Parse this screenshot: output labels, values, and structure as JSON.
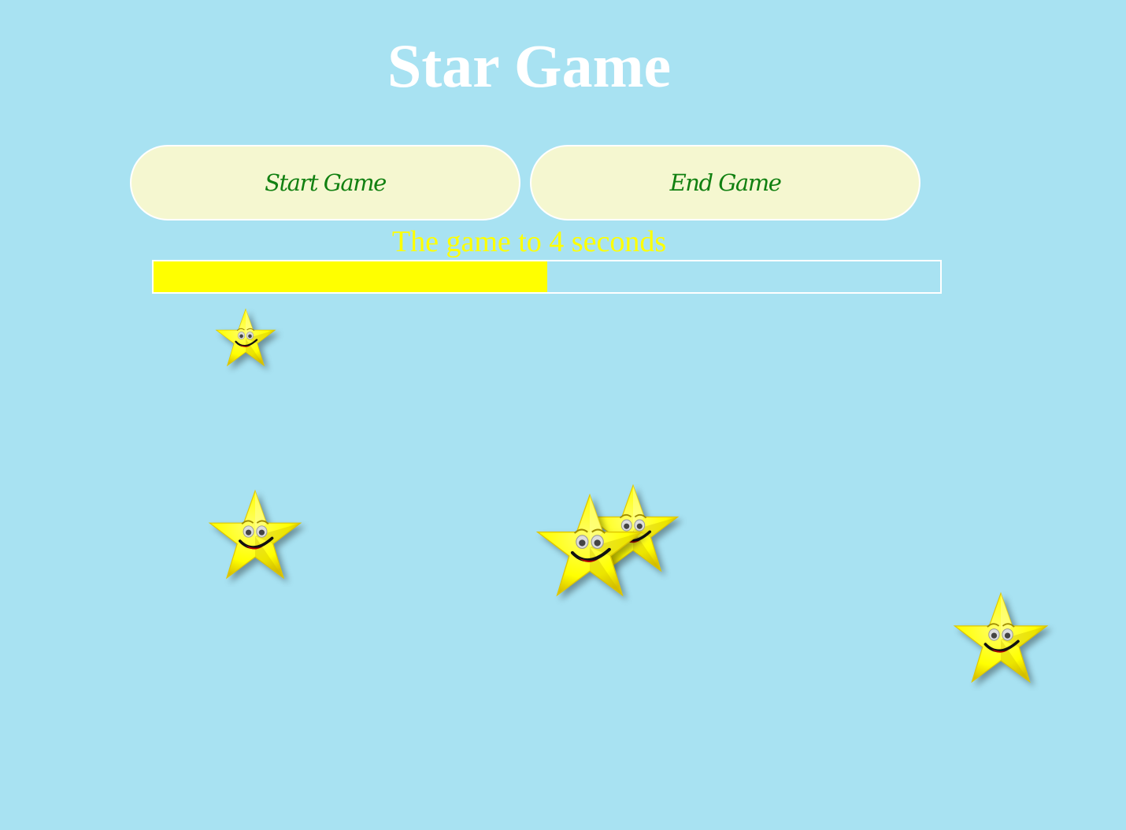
{
  "title": "Star Game",
  "buttons": {
    "start_label": "Start Game",
    "end_label": "End Game"
  },
  "status_text": "The game to 4 seconds",
  "timer": {
    "remaining_fraction": 0.5
  },
  "colors": {
    "background": "#a8e2f2",
    "title": "#ffffff",
    "button_bg": "#f5f7d0",
    "button_text": "#118011",
    "status_text": "#ffff00",
    "progress_fill": "#ffff00",
    "star_fill": "#ffff00"
  },
  "stars": [
    {
      "icon": "smiling-star-icon"
    },
    {
      "icon": "smiling-star-icon"
    },
    {
      "icon": "smiling-star-icon"
    },
    {
      "icon": "smiling-star-icon"
    },
    {
      "icon": "smiling-star-icon"
    }
  ]
}
